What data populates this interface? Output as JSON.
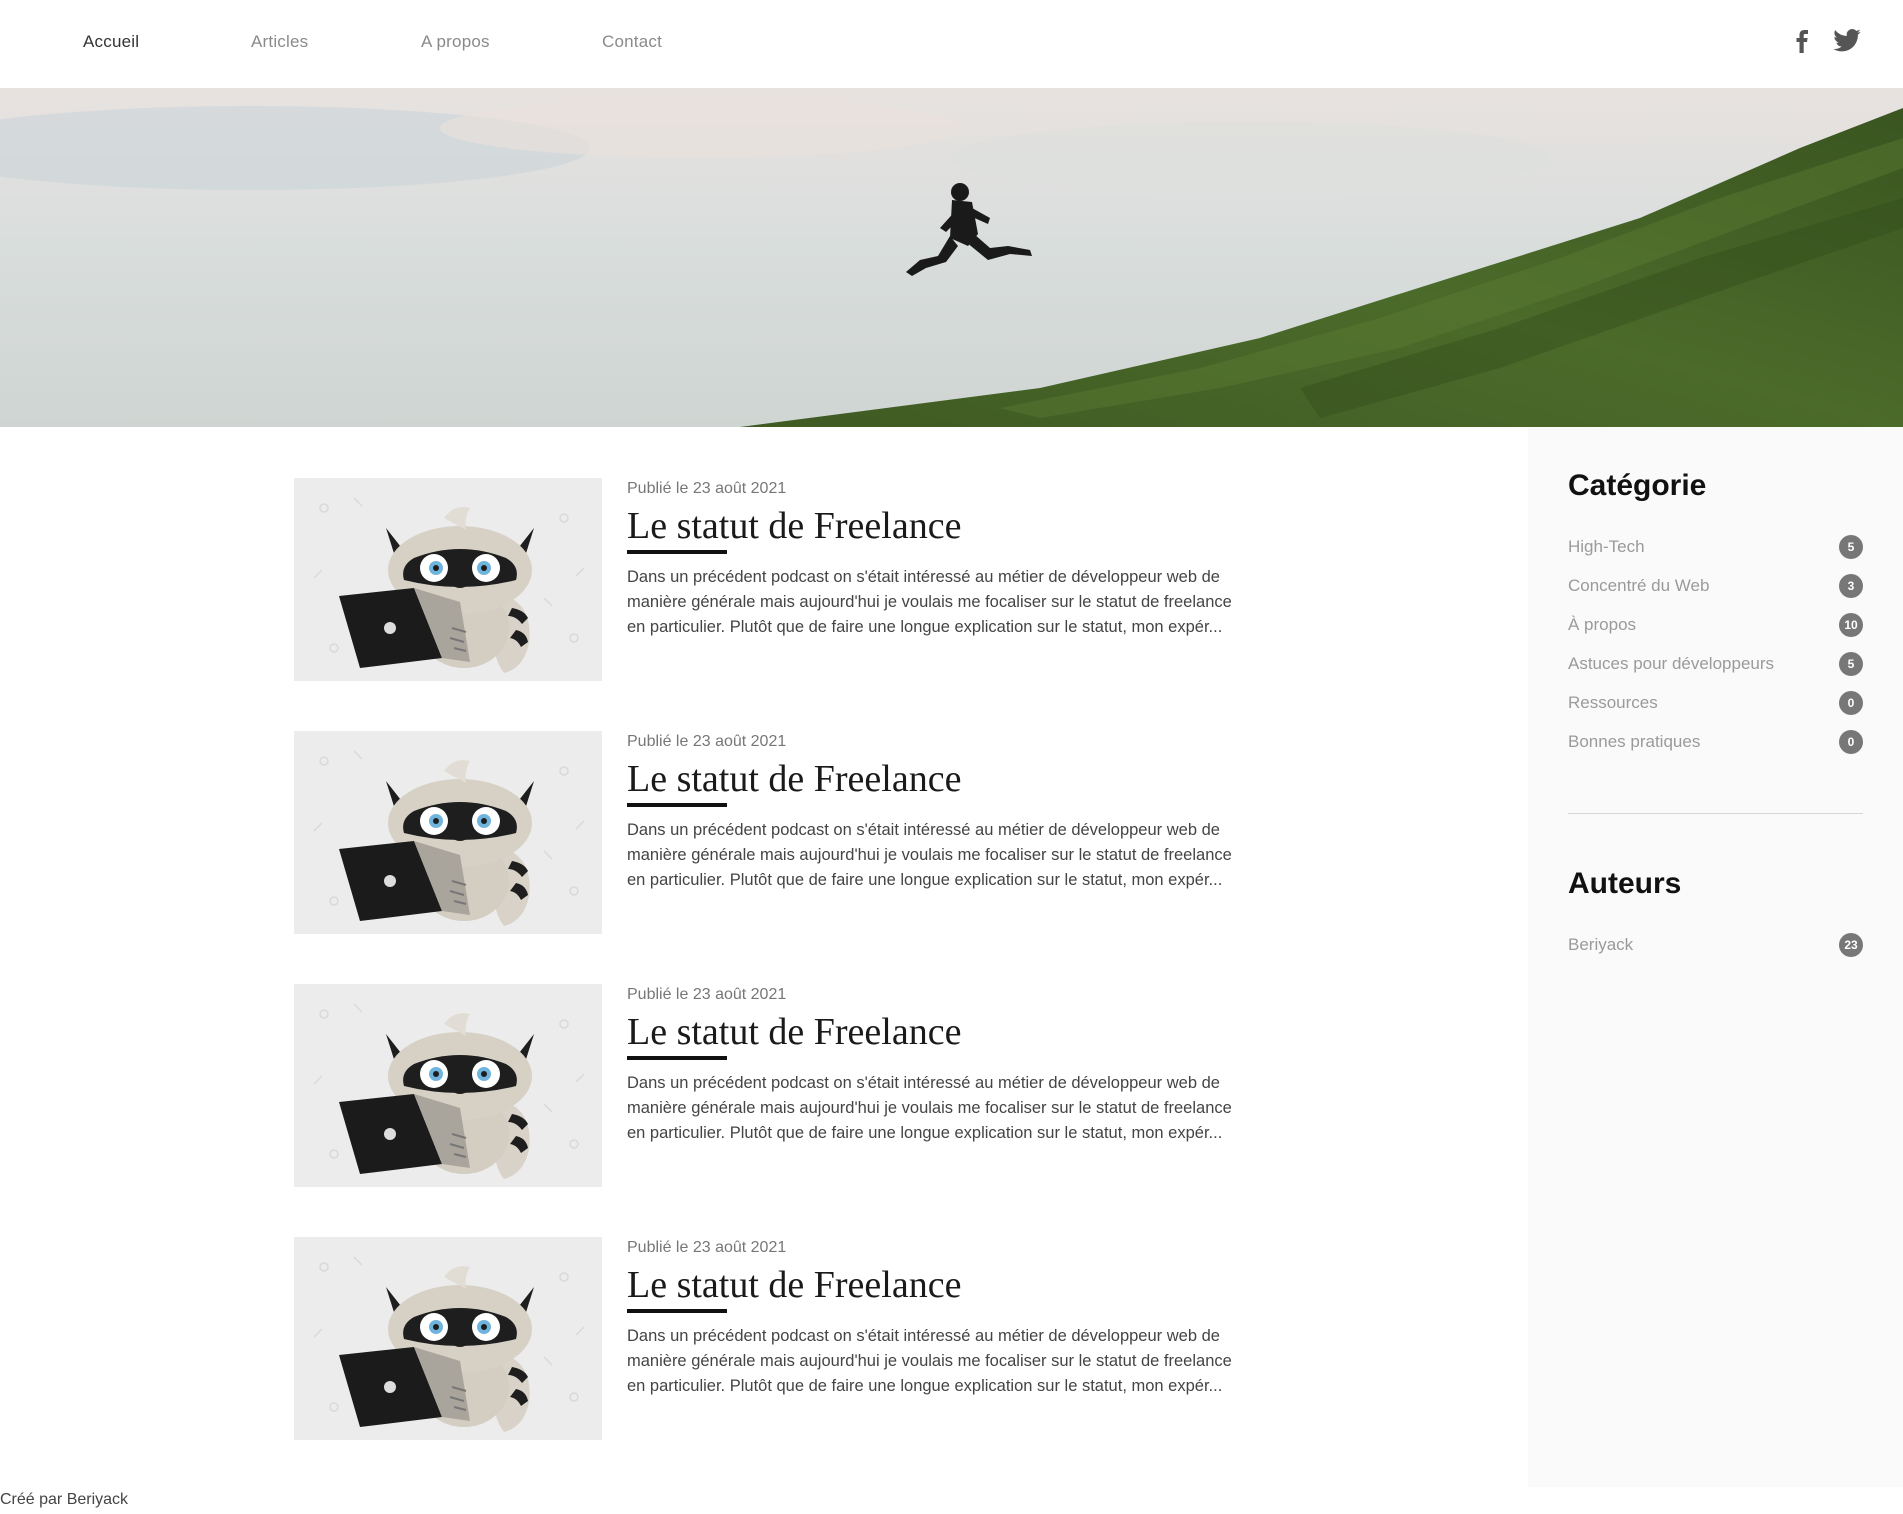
{
  "nav": {
    "items": [
      {
        "label": "Accueil",
        "active": true
      },
      {
        "label": "Articles",
        "active": false
      },
      {
        "label": "A propos",
        "active": false
      },
      {
        "label": "Contact",
        "active": false
      }
    ],
    "social_icons": [
      "facebook-icon",
      "twitter-icon"
    ]
  },
  "articles": [
    {
      "date": "Publié le 23 août 2021",
      "title": "Le statut de Freelance",
      "excerpt": "Dans un précédent podcast on s'était intéressé au métier de développeur web de manière générale mais aujourd'hui je voulais me focaliser sur le statut de freelance en particulier. Plutôt que de faire une longue explication sur le statut, mon expér..."
    },
    {
      "date": "Publié le 23 août 2021",
      "title": "Le statut de Freelance",
      "excerpt": "Dans un précédent podcast on s'était intéressé au métier de développeur web de manière générale mais aujourd'hui je voulais me focaliser sur le statut de freelance en particulier. Plutôt que de faire une longue explication sur le statut, mon expér..."
    },
    {
      "date": "Publié le 23 août 2021",
      "title": "Le statut de Freelance",
      "excerpt": "Dans un précédent podcast on s'était intéressé au métier de développeur web de manière générale mais aujourd'hui je voulais me focaliser sur le statut de freelance en particulier. Plutôt que de faire une longue explication sur le statut, mon expér..."
    },
    {
      "date": "Publié le 23 août 2021",
      "title": "Le statut de Freelance",
      "excerpt": "Dans un précédent podcast on s'était intéressé au métier de développeur web de manière générale mais aujourd'hui je voulais me focaliser sur le statut de freelance en particulier. Plutôt que de faire une longue explication sur le statut, mon expér..."
    }
  ],
  "sidebar": {
    "categories_title": "Catégorie",
    "categories": [
      {
        "label": "High-Tech",
        "count": "5"
      },
      {
        "label": "Concentré du Web",
        "count": "3"
      },
      {
        "label": "À propos",
        "count": "10"
      },
      {
        "label": "Astuces pour développeurs",
        "count": "5"
      },
      {
        "label": "Ressources",
        "count": "0"
      },
      {
        "label": "Bonnes pratiques",
        "count": "0"
      }
    ],
    "authors_title": "Auteurs",
    "authors": [
      {
        "label": "Beriyack",
        "count": "23"
      }
    ]
  },
  "footer": {
    "text": "Créé par Beriyack"
  },
  "colors": {
    "badge": "#777777",
    "title_underline": "#111111",
    "sidebar_bg": "#fafafa"
  }
}
